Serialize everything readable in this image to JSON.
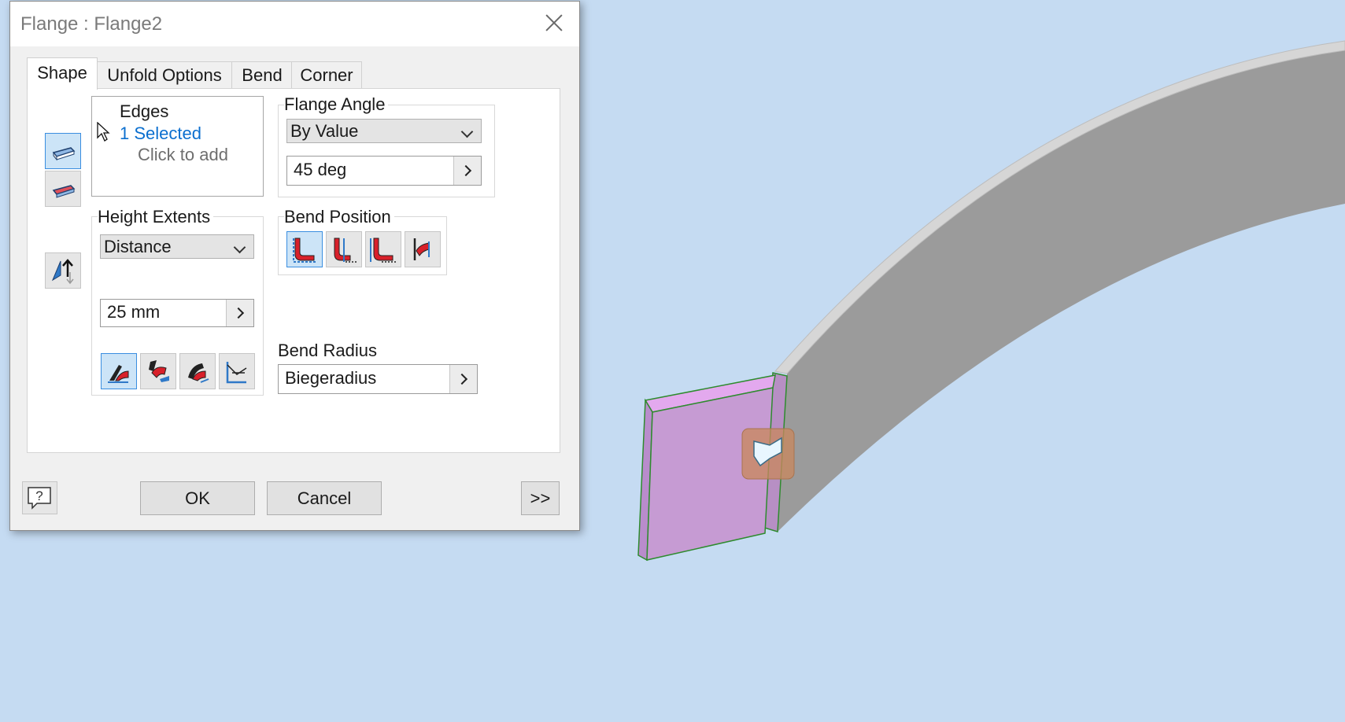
{
  "dialog": {
    "title": "Flange : Flange2",
    "tabs": [
      {
        "label": "Shape",
        "active": true
      },
      {
        "label": "Unfold Options",
        "active": false
      },
      {
        "label": "Bend",
        "active": false
      },
      {
        "label": "Corner",
        "active": false
      }
    ],
    "edges": {
      "label": "Edges",
      "selected_text": "1 Selected",
      "hint": "Click to add"
    },
    "flange_angle": {
      "label": "Flange Angle",
      "mode": "By Value",
      "value": "45 deg"
    },
    "height_extents": {
      "label": "Height Extents",
      "mode": "Distance",
      "value": "25 mm"
    },
    "bend_position": {
      "label": "Bend Position"
    },
    "bend_radius": {
      "label": "Bend Radius",
      "value": "Biegeradius"
    },
    "buttons": {
      "ok": "OK",
      "cancel": "Cancel",
      "more": ">>"
    }
  },
  "colors": {
    "viewport_bg": "#c5dbf2",
    "flange_face": "#c99ad6",
    "part_side": "#9b9b9b",
    "part_top": "#d8d8d8",
    "selection_accent": "#0b6fcf"
  },
  "icons": [
    "edge-select-icon",
    "face-select-icon",
    "flip-direction-icon",
    "help-icon",
    "height-datum-icons",
    "bend-position-icons",
    "flange-glyph-icon",
    "cursor-icon"
  ]
}
